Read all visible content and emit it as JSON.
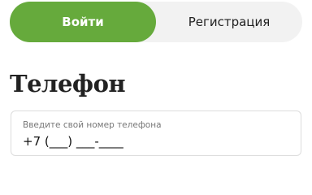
{
  "tabs": {
    "login_label": "Войти",
    "register_label": "Регистрация",
    "active": "login"
  },
  "phone_section": {
    "title": "Телефон",
    "placeholder": "Введите свой номер телефона",
    "mask_value": "+7 (___) ___-____"
  },
  "colors": {
    "accent": "#66aa3c",
    "tab_background": "#f2f2f2",
    "field_border": "#dddddd"
  }
}
